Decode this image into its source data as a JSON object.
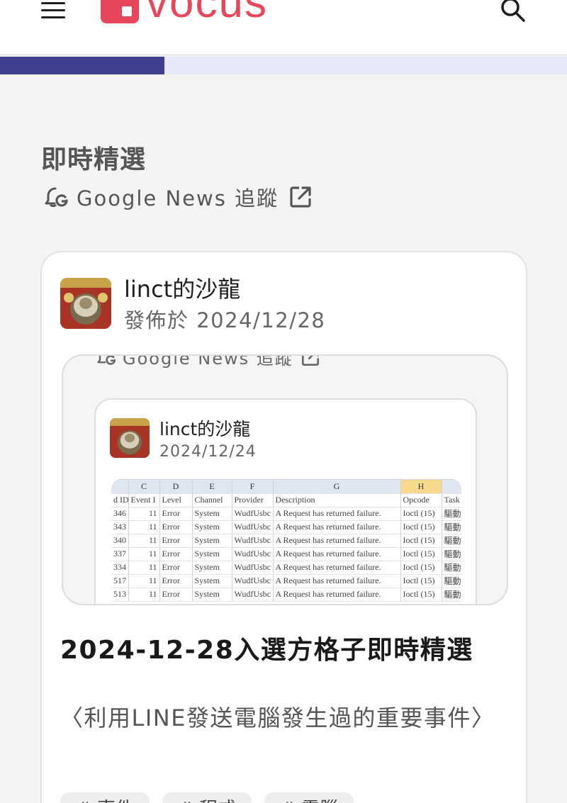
{
  "header": {
    "brand": "vocus",
    "menu_icon": "hamburger-menu-icon",
    "search_icon": "search-icon",
    "brand_color": "#e8475b"
  },
  "progress": {
    "fraction": 0.29,
    "fill_color": "#3f3f8f",
    "track_color": "#e7e8f7"
  },
  "section": {
    "title": "即時精選",
    "follow": {
      "icon": "google-news-icon",
      "label": "Google News 追蹤",
      "link_icon": "external-link-icon"
    }
  },
  "post": {
    "author_name": "linct的沙龍",
    "published": "發佈於 2024/12/28",
    "title": "2024-12-28入選方格子即時精選",
    "excerpt": "〈利用LINE發送電腦發生過的重要事件〉",
    "tags": [
      "# 事件",
      "# 程式",
      "# 電腦"
    ],
    "preview": {
      "follow_label": "Google News 追蹤",
      "inner_author": "linct的沙龍",
      "inner_date": "2024/12/24",
      "sheet": {
        "columns": [
          "C",
          "D",
          "E",
          "F",
          "G",
          "H",
          ""
        ],
        "header_row": [
          "d ID",
          "Event I",
          "Level",
          "Channel",
          "Provider",
          "Description",
          "Opcode",
          "Task"
        ],
        "rows": [
          [
            "346",
            "11",
            "Error",
            "System",
            "WudfUsbc",
            "A Request has returned failure.",
            "Ioctl (15)",
            "驅動"
          ],
          [
            "343",
            "11",
            "Error",
            "System",
            "WudfUsbc",
            "A Request has returned failure.",
            "Ioctl (15)",
            "驅動"
          ],
          [
            "340",
            "11",
            "Error",
            "System",
            "WudfUsbc",
            "A Request has returned failure.",
            "Ioctl (15)",
            "驅動"
          ],
          [
            "337",
            "11",
            "Error",
            "System",
            "WudfUsbc",
            "A Request has returned failure.",
            "Ioctl (15)",
            "驅動"
          ],
          [
            "334",
            "11",
            "Error",
            "System",
            "WudfUsbc",
            "A Request has returned failure.",
            "Ioctl (15)",
            "驅動"
          ],
          [
            "517",
            "11",
            "Error",
            "System",
            "WudfUsbc",
            "A Request has returned failure.",
            "Ioctl (15)",
            "驅動"
          ],
          [
            "513",
            "11",
            "Error",
            "System",
            "WudfUsbc",
            "A Request has returned failure.",
            "Ioctl (15)",
            "驅動"
          ]
        ]
      }
    }
  }
}
